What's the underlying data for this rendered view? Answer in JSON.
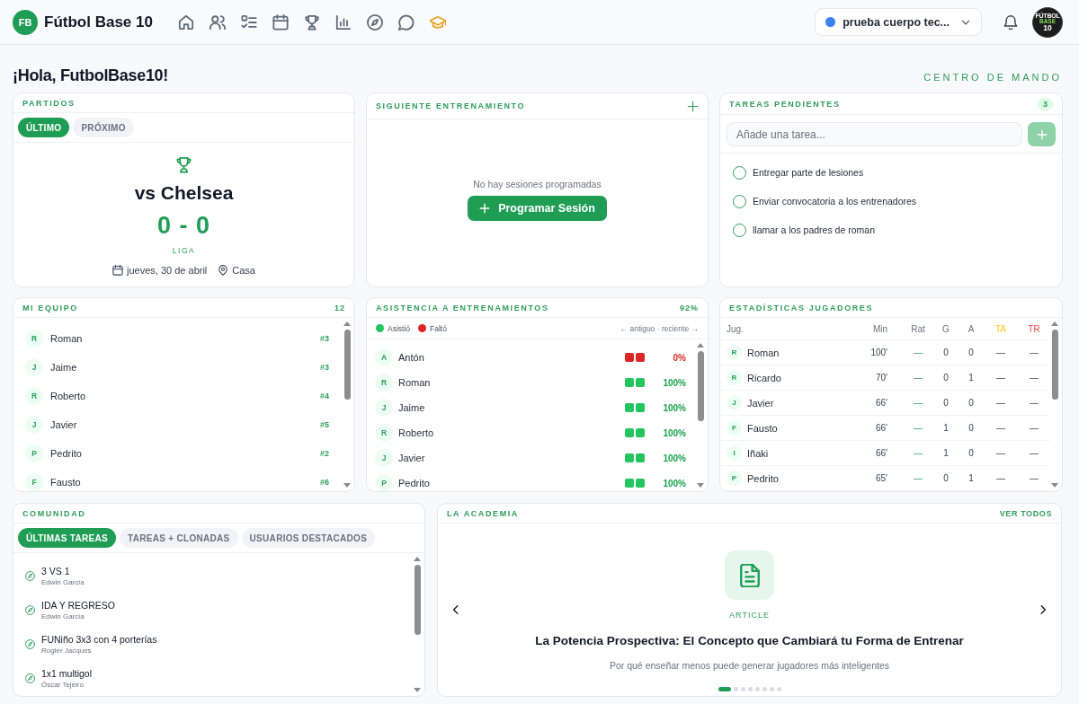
{
  "header": {
    "logo": "FB",
    "title": "Fútbol Base 10",
    "nav": [
      {
        "kind": "home",
        "color": "#5f6b7a"
      },
      {
        "kind": "users",
        "color": "#5f6b7a"
      },
      {
        "kind": "checklist",
        "color": "#5f6b7a"
      },
      {
        "kind": "calendar",
        "color": "#5f6b7a"
      },
      {
        "kind": "trophy",
        "color": "#5f6b7a"
      },
      {
        "kind": "bar-chart",
        "color": "#5f6b7a"
      },
      {
        "kind": "compass",
        "color": "#5f6b7a"
      },
      {
        "kind": "chat",
        "color": "#5f6b7a"
      },
      {
        "kind": "graduation-cap",
        "color": "#e5a526"
      }
    ],
    "team_selector": {
      "label": "prueba cuerpo tec...",
      "color": "#3b82f6"
    },
    "avatar": [
      "FÚTBOL",
      "BASE",
      "10"
    ]
  },
  "greeting": "¡Hola, FutbolBase10!",
  "command_center": "CENTRO DE MANDO",
  "partidos": {
    "title": "PARTIDOS",
    "tabs": [
      {
        "label": "ÚLTIMO",
        "selected": true
      },
      {
        "label": "PRÓXIMO",
        "selected": false
      }
    ],
    "opponent": "vs Chelsea",
    "score": "0 - 0",
    "competition": "LIGA",
    "date": "jueves, 30 de abril",
    "venue": "Casa"
  },
  "siguiente_entrenamiento": {
    "title": "SIGUIENTE ENTRENAMIENTO",
    "empty_text": "No hay sesiones programadas",
    "button": "Programar Sesión"
  },
  "tareas_pendientes": {
    "title": "TAREAS PENDIENTES",
    "count": "3",
    "input": {
      "placeholder": "Añade una tarea..."
    },
    "add_button": {
      "disabled": true
    },
    "tasks": [
      {
        "label": "Entregar parte de lesiones",
        "checked": false
      },
      {
        "label": "Enviar convocatoria a los entrenadores",
        "checked": false
      },
      {
        "label": "llamar a los padres de roman",
        "checked": false
      }
    ]
  },
  "mi_equipo": {
    "title": "MI EQUIPO",
    "count": "12",
    "players": [
      {
        "initial": "R",
        "name": "Roman",
        "number": "#3"
      },
      {
        "initial": "J",
        "name": "Jaime",
        "number": "#3"
      },
      {
        "initial": "R",
        "name": "Roberto",
        "number": "#4"
      },
      {
        "initial": "J",
        "name": "Javier",
        "number": "#5"
      },
      {
        "initial": "P",
        "name": "Pedrito",
        "number": "#2"
      },
      {
        "initial": "F",
        "name": "Fausto",
        "number": "#6"
      }
    ]
  },
  "asistencia": {
    "title": "ASISTENCIA A ENTRENAMIENTOS",
    "percent": "92%",
    "legend": [
      {
        "label": "Asistió",
        "color": "#22c55e"
      },
      {
        "label": "Faltó",
        "color": "#dc2626"
      }
    ],
    "order_hint": "← antiguo · reciente →",
    "rows": [
      {
        "initial": "A",
        "name": "Antón",
        "sessions": [
          {
            "attended": false
          },
          {
            "attended": false
          }
        ],
        "percent": "0%",
        "color": "#dc2626"
      },
      {
        "initial": "R",
        "name": "Roman",
        "sessions": [
          {
            "attended": true
          },
          {
            "attended": true
          }
        ],
        "percent": "100%",
        "color": "#16a34a"
      },
      {
        "initial": "J",
        "name": "Jaime",
        "sessions": [
          {
            "attended": true
          },
          {
            "attended": true
          }
        ],
        "percent": "100%",
        "color": "#16a34a"
      },
      {
        "initial": "R",
        "name": "Roberto",
        "sessions": [
          {
            "attended": true
          },
          {
            "attended": true
          }
        ],
        "percent": "100%",
        "color": "#16a34a"
      },
      {
        "initial": "J",
        "name": "Javier",
        "sessions": [
          {
            "attended": true
          },
          {
            "attended": true
          }
        ],
        "percent": "100%",
        "color": "#16a34a"
      },
      {
        "initial": "P",
        "name": "Pedrito",
        "sessions": [
          {
            "attended": true
          },
          {
            "attended": true
          }
        ],
        "percent": "100%",
        "color": "#16a34a"
      }
    ]
  },
  "estadisticas": {
    "title": "ESTADÍSTICAS JUGADORES",
    "columns": [
      {
        "label": "Jug.",
        "kind": "player"
      },
      {
        "label": "Min",
        "kind": "minutes"
      },
      {
        "label": "Rat",
        "kind": "rating"
      },
      {
        "label": "G",
        "kind": "number"
      },
      {
        "label": "A",
        "kind": "number"
      },
      {
        "label": "TA",
        "kind": "number",
        "color": "#facc15"
      },
      {
        "label": "TR",
        "kind": "number",
        "color": "#ef4444"
      }
    ],
    "rows": [
      {
        "initial": "R",
        "name": "Roman",
        "values": [
          "100'",
          "—",
          "0",
          "0",
          "—",
          "—"
        ]
      },
      {
        "initial": "R",
        "name": "Ricardo",
        "values": [
          "70'",
          "—",
          "0",
          "1",
          "—",
          "—"
        ]
      },
      {
        "initial": "J",
        "name": "Javier",
        "values": [
          "66'",
          "—",
          "0",
          "0",
          "—",
          "—"
        ]
      },
      {
        "initial": "F",
        "name": "Fausto",
        "values": [
          "66'",
          "—",
          "1",
          "0",
          "—",
          "—"
        ]
      },
      {
        "initial": "I",
        "name": "Iñaki",
        "values": [
          "66'",
          "—",
          "1",
          "0",
          "—",
          "—"
        ]
      },
      {
        "initial": "P",
        "name": "Pedrito",
        "values": [
          "65'",
          "—",
          "0",
          "1",
          "—",
          "—"
        ]
      }
    ]
  },
  "comunidad": {
    "title": "COMUNIDAD",
    "tabs": [
      {
        "label": "ÚLTIMAS TAREAS",
        "selected": true
      },
      {
        "label": "TAREAS + CLONADAS",
        "selected": false
      },
      {
        "label": "USUARIOS DESTACADOS",
        "selected": false
      }
    ],
    "items": [
      {
        "title": "3 VS 1",
        "author": "Edwin Garcia"
      },
      {
        "title": "IDA Y REGRESO",
        "author": "Edwin Garcia"
      },
      {
        "title": "FUNiño 3x3 con 4 porterías",
        "author": "Rogier Jacques"
      },
      {
        "title": "1x1 multigol",
        "author": "Óscar Tejeiro"
      }
    ]
  },
  "academia": {
    "title": "LA ACADEMIA",
    "link": "VER TODOS",
    "slide": {
      "type": "ARTICLE",
      "title": "La Potencia Prospectiva: El Concepto que Cambiará tu Forma de Entrenar",
      "subtitle": "Por qué enseñar menos puede generar jugadores más inteligentes"
    },
    "dots": [
      {
        "selected": true
      },
      {
        "selected": false
      },
      {
        "selected": false
      },
      {
        "selected": false
      },
      {
        "selected": false
      },
      {
        "selected": false
      },
      {
        "selected": false
      },
      {
        "selected": false
      }
    ]
  }
}
